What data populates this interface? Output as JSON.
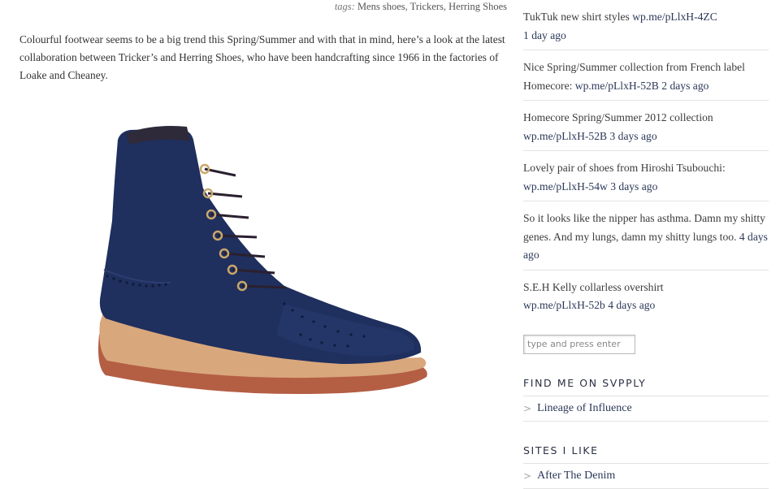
{
  "post": {
    "tags_label": "tags:",
    "tags": [
      "Mens shoes",
      "Trickers",
      "Herring Shoes"
    ],
    "intro": "Colourful footwear seems to be a big trend this Spring/Summer and with that in mind, here’s a look at the latest collaboration between Tricker’s and Herring Shoes, who have been handcrafting since 1966 in the factories of Loake and Cheaney.",
    "image_colors": {
      "suede": "#1f2f5e",
      "sole": "#c47a52",
      "welt": "#d9a77c",
      "eyelets": "#c9a86a"
    }
  },
  "sidebar": {
    "tweets": [
      {
        "text": "TukTuk new shirt styles ",
        "link": "wp.me/pLlxH-4ZC",
        "time": "1 day ago"
      },
      {
        "text": "Nice Spring/Summer collection from French label Homecore: ",
        "link": "wp.me/pLlxH-52B",
        "time": "2 days ago"
      },
      {
        "text": "Homecore Spring/Summer 2012 collection ",
        "link": "wp.me/pLlxH-52B",
        "time": "3 days ago"
      },
      {
        "text": "Lovely pair of shoes from Hiroshi Tsubouchi: ",
        "link": "wp.me/pLlxH-54w",
        "time": "3 days ago"
      },
      {
        "text": "So it looks like the nipper has asthma. Damn my shitty genes. And my lungs, damn my shitty lungs too. ",
        "link": "",
        "time": "4 days ago"
      },
      {
        "text": "S.E.H Kelly collarless overshirt ",
        "link": "wp.me/pLlxH-52b",
        "time": "4 days ago"
      }
    ],
    "search": {
      "placeholder": "type and press enter"
    },
    "svpply": {
      "title": "FIND ME ON SVPPLY",
      "link": "Lineage of Influence"
    },
    "sites": {
      "title": "SITES I LIKE",
      "link": "After The Denim"
    },
    "chevron_glyph": ">"
  }
}
